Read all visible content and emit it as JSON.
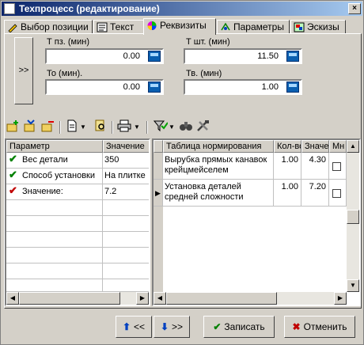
{
  "window": {
    "title": "Техпроцесс (редактирование)",
    "close_label": "×"
  },
  "tabs": [
    {
      "label": "Выбор позиции",
      "icon": "pencil-icon"
    },
    {
      "label": "Текст",
      "icon": "text-document-icon"
    },
    {
      "label": "Реквизиты",
      "icon": "color-wheel-icon"
    },
    {
      "label": "Параметры",
      "icon": "parameters-icon"
    },
    {
      "label": "Эскизы",
      "icon": "sketch-icon"
    }
  ],
  "active_tab": "Реквизиты",
  "side_toggle": ">>",
  "fields": {
    "tpz": {
      "label": "Т пз. (мин)",
      "value": "0.00"
    },
    "tsht": {
      "label": "Т шт. (мин)",
      "value": "11.50"
    },
    "to": {
      "label": "То (мин).",
      "value": "0.00"
    },
    "tv": {
      "label": "Тв. (мин)",
      "value": "1.00"
    }
  },
  "params_table": {
    "headers": [
      "Параметр",
      "Значение"
    ],
    "rows": [
      {
        "param": "Вес детали",
        "value": "350",
        "check_color": "#008000"
      },
      {
        "param": "Способ установки",
        "value": "На плитке",
        "check_color": "#008000"
      },
      {
        "param": "Значение:",
        "value": "7.2",
        "check_color": "#c00000"
      }
    ]
  },
  "norm_table": {
    "headers": [
      "Таблица нормирования",
      "Кол-во",
      "Значение",
      "Мн"
    ],
    "rows": [
      {
        "line1": "Вырубка прямых канавок",
        "line2": "крейцмейселем",
        "qty": "1.00",
        "value": "4.30"
      },
      {
        "line1": "Установка деталей",
        "line2": "средней сложности",
        "qty": "1.00",
        "value": "7.20"
      }
    ]
  },
  "buttons": {
    "prev": "<<",
    "next": ">>",
    "save": "Записать",
    "cancel": "Отменить"
  },
  "colors": {
    "titlebar_start": "#0a246a",
    "titlebar_end": "#a6caf0",
    "face": "#d4d0c8",
    "save_check": "#008000",
    "cancel_x": "#c00000",
    "arrow_blue": "#0040c0"
  }
}
